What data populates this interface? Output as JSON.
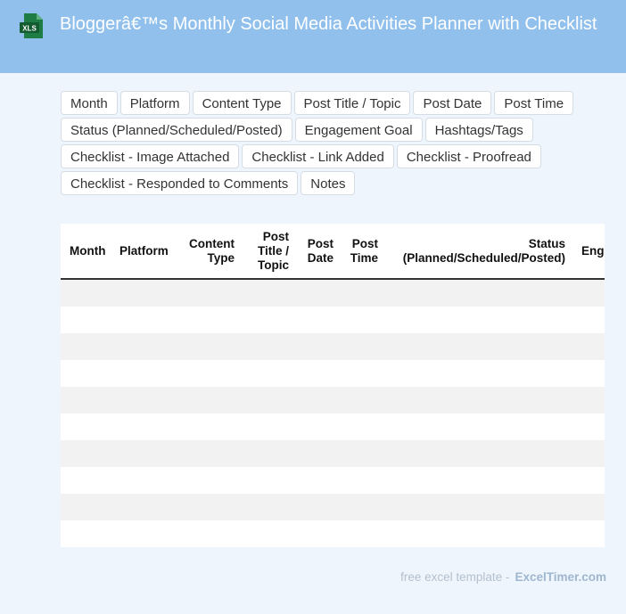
{
  "header": {
    "title": "Bloggerâ€™s Monthly Social Media Activities Planner with Checklist",
    "icon_label": "XLS"
  },
  "tags": [
    "Month",
    "Platform",
    "Content Type",
    "Post Title / Topic",
    "Post Date",
    "Post Time",
    "Status (Planned/Scheduled/Posted)",
    "Engagement Goal",
    "Hashtags/Tags",
    "Checklist - Image Attached",
    "Checklist - Link Added",
    "Checklist - Proofread",
    "Checklist - Responded to Comments",
    "Notes"
  ],
  "table": {
    "columns": [
      "Month",
      "Platform",
      "Content Type",
      "Post Title / Topic",
      "Post Date",
      "Post Time",
      "Status (Planned/Scheduled/Posted)",
      "Eng"
    ],
    "row_count": 10
  },
  "footer": {
    "text": "free excel template -",
    "brand": "ExcelTimer.com"
  },
  "colors": {
    "header_bg": "#91c0ec",
    "page_bg": "#eef5fd",
    "icon_green": "#1e7d45"
  }
}
